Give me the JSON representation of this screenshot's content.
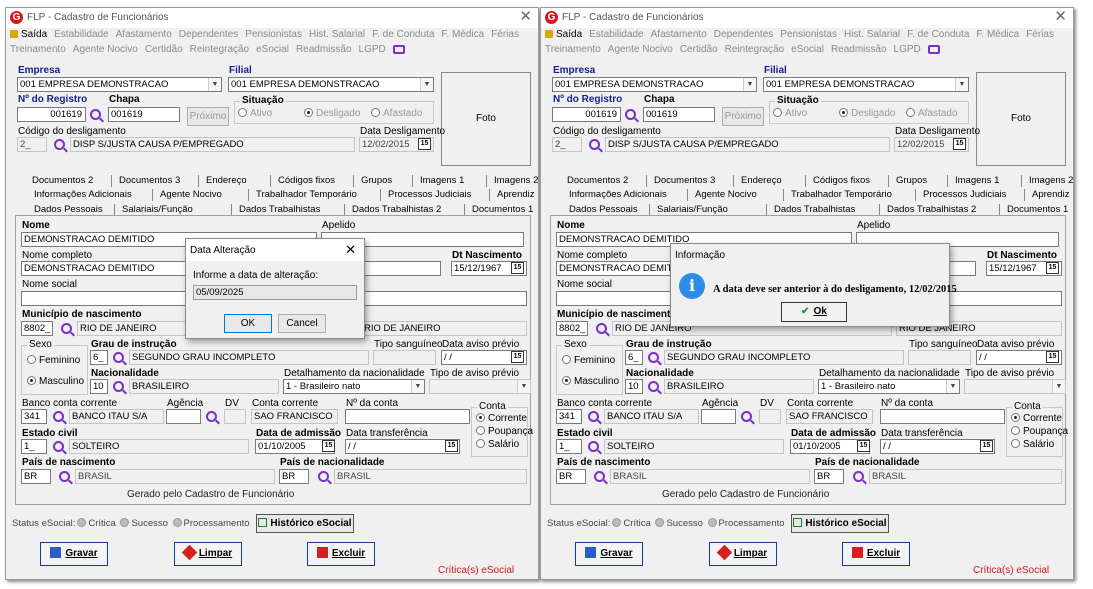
{
  "window": {
    "title": "FLP - Cadastro de Funcionários",
    "close": "✕"
  },
  "menu1": [
    "Saída",
    "Estabilidade",
    "Afastamento",
    "Dependentes",
    "Pensionistas",
    "Hist. Salarial",
    "F. de Conduta",
    "F. Médica",
    "Férias"
  ],
  "menu2": [
    "Treinamento",
    "Agente Nocivo",
    "Certidão",
    "Reintegração",
    "eSocial",
    "Readmissão",
    "LGPD"
  ],
  "form": {
    "empresa_label": "Empresa",
    "empresa": "001 EMPRESA DEMONSTRACAO",
    "filial_label": "Filial",
    "filial": "001 EMPRESA DEMONSTRACAO",
    "registro_label": "Nº do Registro",
    "registro": "001619",
    "chapa_label": "Chapa",
    "chapa": "001619",
    "proximo": "Próximo",
    "situacao_label": "Situação",
    "sit_ativo": "Ativo",
    "sit_desligado": "Desligado",
    "sit_afastado": "Afastado",
    "foto": "Foto",
    "cod_desl_label": "Código do desligamento",
    "cod_desl": "2_",
    "desc_desl": "DISP S/JUSTA CAUSA P/EMPREGADO",
    "data_desl_label": "Data Desligamento",
    "data_desl": "12/02/2015",
    "nome_label": "Nome",
    "nome": "DEMONSTRACAO DEMITIDO",
    "apelido_label": "Apelido",
    "nome_comp_label": "Nome completo",
    "nome_comp": "DEMONSTRACAO DEMITIDO",
    "dt_nasc_label": "Dt Nascimento",
    "dt_nasc": "15/12/1967",
    "nome_social_label": "Nome social",
    "municipio_label": "Município de nascimento",
    "mun_cod": "8802_",
    "mun_nome": "RIO DE JANEIRO",
    "uf_nome": "RIO DE JANEIRO",
    "sexo_label": "Sexo",
    "feminino": "Feminino",
    "masculino": "Masculino",
    "grau_label": "Grau de instrução",
    "grau_cod": "6_",
    "grau_nome": "SEGUNDO GRAU INCOMPLETO",
    "tipo_sang_label": "Tipo sanguíneo",
    "data_aviso_label": "Data aviso prévio",
    "data_aviso": " / /",
    "nac_label": "Nacionalidade",
    "nac_cod": "10",
    "nac_nome": "BRASILEIRO",
    "det_nac_label": "Detalhamento da nacionalidade",
    "det_nac": "1 - Brasileiro nato",
    "tipo_aviso_label": "Tipo de aviso prévio",
    "banco_label": "Banco conta corrente",
    "banco_cod": "341",
    "banco_nome": "BANCO ITAU S/A",
    "agencia_label": "Agência",
    "dv_label": "DV",
    "conta_label": "Conta corrente",
    "conta_nome": "SAO FRANCISCO",
    "nconta_label": "Nº da conta",
    "conta_grp": "Conta",
    "corrente": "Corrente",
    "poupanca": "Poupança",
    "salario": "Salário",
    "estado_civil_label": "Estado civil",
    "ec_cod": "1_",
    "ec_nome": "SOLTEIRO",
    "dt_adm_label": "Data de admissão",
    "dt_adm": "01/10/2005",
    "dt_transf_label": "Data transferência",
    "dt_transf": " / /",
    "pais_nasc_label": "País de nascimento",
    "pais_cod": "BR",
    "pais_nome": "BRASIL",
    "pais_nac_label": "País de nacionalidade",
    "pais_nac_cod": "BR",
    "pais_nac_nome": "BRASIL",
    "gerado": "Gerado pelo Cadastro de Funcionário"
  },
  "tabs_row1": [
    "Documentos 2",
    "Documentos 3",
    "Endereço",
    "Códigos fixos",
    "Grupos",
    "Imagens 1",
    "Imagens 2"
  ],
  "tabs_row2": [
    "Informações Adicionais",
    "Agente Nocivo",
    "Trabalhador Temporário",
    "Processos Judiciais",
    "Aprendiz"
  ],
  "tabs_row3": [
    "Dados Pessoais",
    "Salariais/Função",
    "Dados Trabalhistas",
    "Dados Trabalhistas 2",
    "Documentos 1"
  ],
  "status": {
    "label": "Status eSocial:",
    "critica": "Crítica",
    "sucesso": "Sucesso",
    "processamento": "Processamento",
    "historico": "Histórico eSocial",
    "criticas": "Crítica(s) eSocial"
  },
  "buttons": {
    "gravar": "Gravar",
    "limpar": "Limpar",
    "excluir": "Excluir"
  },
  "dialog_left": {
    "title": "Data Alteração",
    "prompt": "Informe a data de alteração:",
    "value": "05/09/2025",
    "ok": "OK",
    "cancel": "Cancel",
    "close": "✕"
  },
  "dialog_right": {
    "title": "Informação",
    "message": "A data deve ser anterior à do desligamento, 12/02/2015",
    "ok": "Ok"
  },
  "colors": {
    "accent": "#7b2fc8",
    "label_blue": "#15238a",
    "critica_red": "#d9161c"
  }
}
